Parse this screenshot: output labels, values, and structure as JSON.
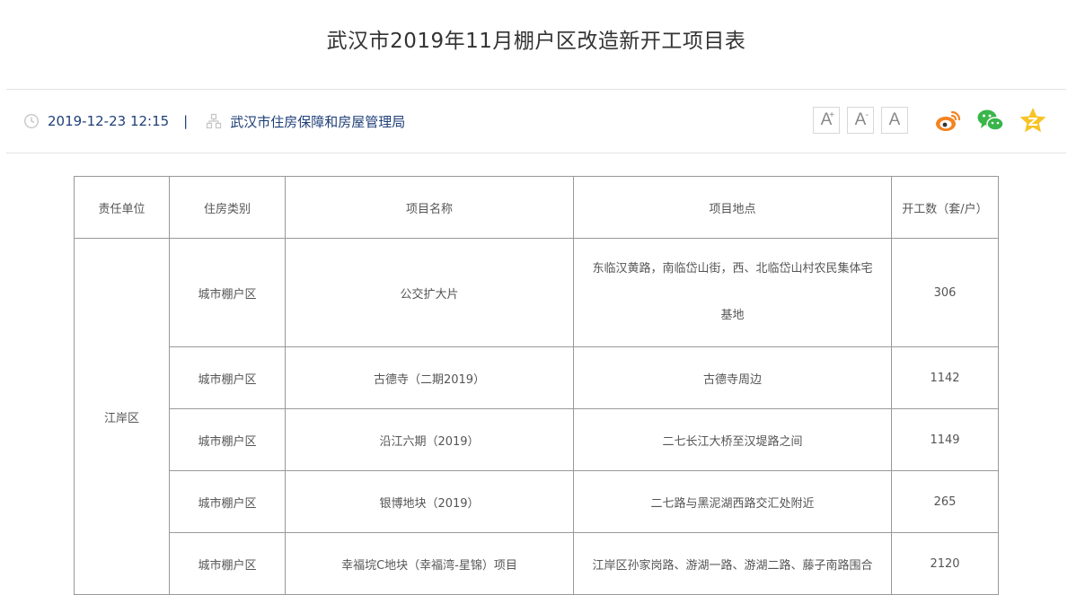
{
  "article": {
    "title": "武汉市2019年11月棚户区改造新开工项目表",
    "date": "2019-12-23 12:15",
    "separator": "|",
    "source": "武汉市住房保障和房屋管理局"
  },
  "font_controls": [
    {
      "label": "A",
      "sup": "+"
    },
    {
      "label": "A",
      "sup": "-"
    },
    {
      "label": "A",
      "sup": ""
    }
  ],
  "share_icons": [
    "weibo-icon",
    "wechat-icon",
    "qzone-icon"
  ],
  "colors": {
    "meta_text": "#1f3f78",
    "weibo": "#f5821f",
    "wechat": "#39b54a",
    "qzone": "#f7c325"
  },
  "table": {
    "headers": [
      "责任单位",
      "住房类别",
      "项目名称",
      "项目地点",
      "开工数（套/户）"
    ],
    "unit": "江岸区",
    "rows": [
      {
        "type": "城市棚户区",
        "name": "公交扩大片",
        "location_line1": "东临汉黄路，南临岱山街，西、北临岱山村农民集体宅",
        "location_line2": "基地",
        "count": "306"
      },
      {
        "type": "城市棚户区",
        "name": "古德寺（二期2019）",
        "location": "古德寺周边",
        "count": "1142"
      },
      {
        "type": "城市棚户区",
        "name": "沿江六期（2019）",
        "location": "二七长江大桥至汉堤路之间",
        "count": "1149"
      },
      {
        "type": "城市棚户区",
        "name": "银博地块（2019）",
        "location": "二七路与黑泥湖西路交汇处附近",
        "count": "265"
      },
      {
        "type": "城市棚户区",
        "name": "幸福垸C地块（幸福湾-星锦）项目",
        "location": "江岸区孙家岗路、游湖一路、游湖二路、藤子南路围合",
        "count": "2120"
      }
    ]
  }
}
